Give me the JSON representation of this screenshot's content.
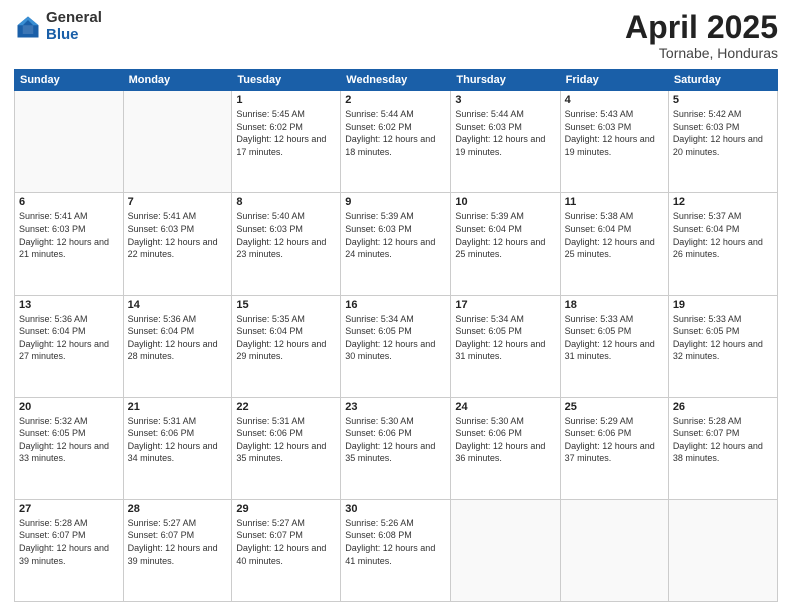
{
  "logo": {
    "general": "General",
    "blue": "Blue"
  },
  "title": {
    "month": "April 2025",
    "location": "Tornabe, Honduras"
  },
  "weekdays": [
    "Sunday",
    "Monday",
    "Tuesday",
    "Wednesday",
    "Thursday",
    "Friday",
    "Saturday"
  ],
  "weeks": [
    [
      {
        "day": "",
        "info": ""
      },
      {
        "day": "",
        "info": ""
      },
      {
        "day": "1",
        "info": "Sunrise: 5:45 AM\nSunset: 6:02 PM\nDaylight: 12 hours and 17 minutes."
      },
      {
        "day": "2",
        "info": "Sunrise: 5:44 AM\nSunset: 6:02 PM\nDaylight: 12 hours and 18 minutes."
      },
      {
        "day": "3",
        "info": "Sunrise: 5:44 AM\nSunset: 6:03 PM\nDaylight: 12 hours and 19 minutes."
      },
      {
        "day": "4",
        "info": "Sunrise: 5:43 AM\nSunset: 6:03 PM\nDaylight: 12 hours and 19 minutes."
      },
      {
        "day": "5",
        "info": "Sunrise: 5:42 AM\nSunset: 6:03 PM\nDaylight: 12 hours and 20 minutes."
      }
    ],
    [
      {
        "day": "6",
        "info": "Sunrise: 5:41 AM\nSunset: 6:03 PM\nDaylight: 12 hours and 21 minutes."
      },
      {
        "day": "7",
        "info": "Sunrise: 5:41 AM\nSunset: 6:03 PM\nDaylight: 12 hours and 22 minutes."
      },
      {
        "day": "8",
        "info": "Sunrise: 5:40 AM\nSunset: 6:03 PM\nDaylight: 12 hours and 23 minutes."
      },
      {
        "day": "9",
        "info": "Sunrise: 5:39 AM\nSunset: 6:03 PM\nDaylight: 12 hours and 24 minutes."
      },
      {
        "day": "10",
        "info": "Sunrise: 5:39 AM\nSunset: 6:04 PM\nDaylight: 12 hours and 25 minutes."
      },
      {
        "day": "11",
        "info": "Sunrise: 5:38 AM\nSunset: 6:04 PM\nDaylight: 12 hours and 25 minutes."
      },
      {
        "day": "12",
        "info": "Sunrise: 5:37 AM\nSunset: 6:04 PM\nDaylight: 12 hours and 26 minutes."
      }
    ],
    [
      {
        "day": "13",
        "info": "Sunrise: 5:36 AM\nSunset: 6:04 PM\nDaylight: 12 hours and 27 minutes."
      },
      {
        "day": "14",
        "info": "Sunrise: 5:36 AM\nSunset: 6:04 PM\nDaylight: 12 hours and 28 minutes."
      },
      {
        "day": "15",
        "info": "Sunrise: 5:35 AM\nSunset: 6:04 PM\nDaylight: 12 hours and 29 minutes."
      },
      {
        "day": "16",
        "info": "Sunrise: 5:34 AM\nSunset: 6:05 PM\nDaylight: 12 hours and 30 minutes."
      },
      {
        "day": "17",
        "info": "Sunrise: 5:34 AM\nSunset: 6:05 PM\nDaylight: 12 hours and 31 minutes."
      },
      {
        "day": "18",
        "info": "Sunrise: 5:33 AM\nSunset: 6:05 PM\nDaylight: 12 hours and 31 minutes."
      },
      {
        "day": "19",
        "info": "Sunrise: 5:33 AM\nSunset: 6:05 PM\nDaylight: 12 hours and 32 minutes."
      }
    ],
    [
      {
        "day": "20",
        "info": "Sunrise: 5:32 AM\nSunset: 6:05 PM\nDaylight: 12 hours and 33 minutes."
      },
      {
        "day": "21",
        "info": "Sunrise: 5:31 AM\nSunset: 6:06 PM\nDaylight: 12 hours and 34 minutes."
      },
      {
        "day": "22",
        "info": "Sunrise: 5:31 AM\nSunset: 6:06 PM\nDaylight: 12 hours and 35 minutes."
      },
      {
        "day": "23",
        "info": "Sunrise: 5:30 AM\nSunset: 6:06 PM\nDaylight: 12 hours and 35 minutes."
      },
      {
        "day": "24",
        "info": "Sunrise: 5:30 AM\nSunset: 6:06 PM\nDaylight: 12 hours and 36 minutes."
      },
      {
        "day": "25",
        "info": "Sunrise: 5:29 AM\nSunset: 6:06 PM\nDaylight: 12 hours and 37 minutes."
      },
      {
        "day": "26",
        "info": "Sunrise: 5:28 AM\nSunset: 6:07 PM\nDaylight: 12 hours and 38 minutes."
      }
    ],
    [
      {
        "day": "27",
        "info": "Sunrise: 5:28 AM\nSunset: 6:07 PM\nDaylight: 12 hours and 39 minutes."
      },
      {
        "day": "28",
        "info": "Sunrise: 5:27 AM\nSunset: 6:07 PM\nDaylight: 12 hours and 39 minutes."
      },
      {
        "day": "29",
        "info": "Sunrise: 5:27 AM\nSunset: 6:07 PM\nDaylight: 12 hours and 40 minutes."
      },
      {
        "day": "30",
        "info": "Sunrise: 5:26 AM\nSunset: 6:08 PM\nDaylight: 12 hours and 41 minutes."
      },
      {
        "day": "",
        "info": ""
      },
      {
        "day": "",
        "info": ""
      },
      {
        "day": "",
        "info": ""
      }
    ]
  ]
}
